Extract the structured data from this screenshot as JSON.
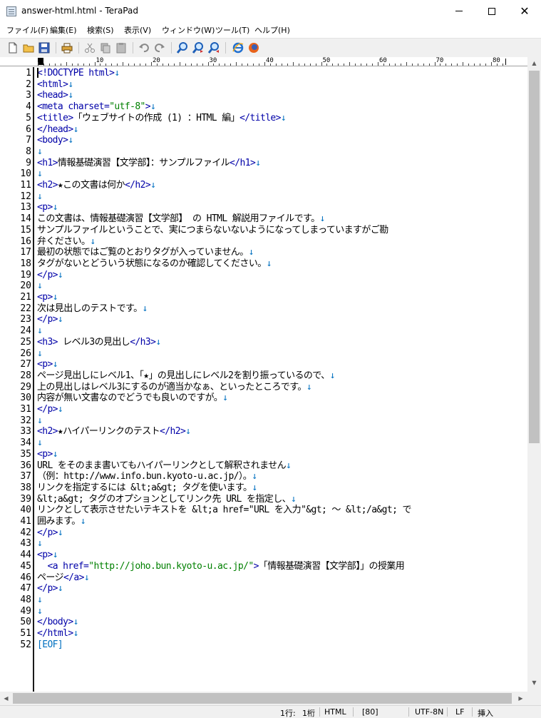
{
  "window": {
    "title": "answer-html.html - TeraPad",
    "min_glyph": "",
    "max_glyph": "",
    "close_glyph": "✕"
  },
  "menu": [
    "ファイル(F)",
    "編集(E)",
    "検索(S)",
    "表示(V)",
    "ウィンドウ(W)",
    "ツール(T)",
    "ヘルプ(H)"
  ],
  "toolbar": {
    "icons": [
      "new-file-icon",
      "open-folder-icon",
      "save-icon",
      "print-icon",
      "cut-icon",
      "copy-icon",
      "paste-icon",
      "undo-icon",
      "redo-icon",
      "find-icon",
      "find-next-icon",
      "find-prev-icon",
      "ie-browser-icon",
      "firefox-browser-icon"
    ]
  },
  "ruler": {
    "labels": [
      "0",
      "10",
      "20",
      "30",
      "40",
      "50",
      "60",
      "70",
      "80"
    ]
  },
  "editor": {
    "newline_mark": "↓",
    "eof_label": "[EOF]",
    "lines": [
      {
        "n": "1",
        "parts": [
          [
            "tag",
            "<!DOCTYPE html>"
          ],
          [
            "nl",
            "↓"
          ]
        ]
      },
      {
        "n": "2",
        "parts": [
          [
            "tag",
            "<html>"
          ],
          [
            "nl",
            "↓"
          ]
        ]
      },
      {
        "n": "3",
        "parts": [
          [
            "tag",
            "<head>"
          ],
          [
            "nl",
            "↓"
          ]
        ]
      },
      {
        "n": "4",
        "parts": [
          [
            "tag",
            "<meta charset="
          ],
          [
            "str",
            "\"utf-8\""
          ],
          [
            "tag",
            ">"
          ],
          [
            "nl",
            "↓"
          ]
        ]
      },
      {
        "n": "5",
        "parts": [
          [
            "tag",
            "<title>"
          ],
          [
            "txt",
            "「ウェブサイトの作成 (1) ：HTML 編」"
          ],
          [
            "tag",
            "</title>"
          ],
          [
            "nl",
            "↓"
          ]
        ]
      },
      {
        "n": "6",
        "parts": [
          [
            "tag",
            "</head>"
          ],
          [
            "nl",
            "↓"
          ]
        ]
      },
      {
        "n": "7",
        "parts": [
          [
            "tag",
            "<body>"
          ],
          [
            "nl",
            "↓"
          ]
        ]
      },
      {
        "n": "8",
        "parts": [
          [
            "nl",
            "↓"
          ]
        ]
      },
      {
        "n": "9",
        "parts": [
          [
            "tag",
            "<h1>"
          ],
          [
            "txt",
            "情報基礎演習【文学部】：サンプルファイル"
          ],
          [
            "tag",
            "</h1>"
          ],
          [
            "nl",
            "↓"
          ]
        ]
      },
      {
        "n": "10",
        "parts": [
          [
            "nl",
            "↓"
          ]
        ]
      },
      {
        "n": "11",
        "parts": [
          [
            "tag",
            "<h2>"
          ],
          [
            "txt",
            "★この文書は何か"
          ],
          [
            "tag",
            "</h2>"
          ],
          [
            "nl",
            "↓"
          ]
        ]
      },
      {
        "n": "12",
        "parts": [
          [
            "nl",
            "↓"
          ]
        ]
      },
      {
        "n": "13",
        "parts": [
          [
            "tag",
            "<p>"
          ],
          [
            "nl",
            "↓"
          ]
        ]
      },
      {
        "n": "14",
        "parts": [
          [
            "txt",
            "この文書は、情報基礎演習【文学部】 の HTML 解説用ファイルです。"
          ],
          [
            "nl",
            "↓"
          ]
        ]
      },
      {
        "n": "15",
        "parts": [
          [
            "txt",
            "サンプルファイルということで、実につまらないないようになってしまっていますがご勘"
          ]
        ]
      },
      {
        "n": "16",
        "parts": [
          [
            "txt",
            "弁ください。"
          ],
          [
            "nl",
            "↓"
          ]
        ]
      },
      {
        "n": "17",
        "parts": [
          [
            "txt",
            "最初の状態ではご覧のとおりタグが入っていません。"
          ],
          [
            "nl",
            "↓"
          ]
        ]
      },
      {
        "n": "18",
        "parts": [
          [
            "txt",
            "タグがないとどういう状態になるのか確認してください。"
          ],
          [
            "nl",
            "↓"
          ]
        ]
      },
      {
        "n": "19",
        "parts": [
          [
            "tag",
            "</p>"
          ],
          [
            "nl",
            "↓"
          ]
        ]
      },
      {
        "n": "20",
        "parts": [
          [
            "nl",
            "↓"
          ]
        ]
      },
      {
        "n": "21",
        "parts": [
          [
            "tag",
            "<p>"
          ],
          [
            "nl",
            "↓"
          ]
        ]
      },
      {
        "n": "22",
        "parts": [
          [
            "txt",
            "次は見出しのテストです。"
          ],
          [
            "nl",
            "↓"
          ]
        ]
      },
      {
        "n": "23",
        "parts": [
          [
            "tag",
            "</p>"
          ],
          [
            "nl",
            "↓"
          ]
        ]
      },
      {
        "n": "24",
        "parts": [
          [
            "nl",
            "↓"
          ]
        ]
      },
      {
        "n": "25",
        "parts": [
          [
            "tag",
            "<h3>"
          ],
          [
            "txt",
            " レベル3の見出し"
          ],
          [
            "tag",
            "</h3>"
          ],
          [
            "nl",
            "↓"
          ]
        ]
      },
      {
        "n": "26",
        "parts": [
          [
            "nl",
            "↓"
          ]
        ]
      },
      {
        "n": "27",
        "parts": [
          [
            "tag",
            "<p>"
          ],
          [
            "nl",
            "↓"
          ]
        ]
      },
      {
        "n": "28",
        "parts": [
          [
            "txt",
            "ページ見出しにレベル1、「★」の見出しにレベル2を割り振っているので、"
          ],
          [
            "nl",
            "↓"
          ]
        ]
      },
      {
        "n": "29",
        "parts": [
          [
            "txt",
            "上の見出しはレベル3にするのが適当かなぁ、といったところです。"
          ],
          [
            "nl",
            "↓"
          ]
        ]
      },
      {
        "n": "30",
        "parts": [
          [
            "txt",
            "内容が無い文書なのでどうでも良いのですが。"
          ],
          [
            "nl",
            "↓"
          ]
        ]
      },
      {
        "n": "31",
        "parts": [
          [
            "tag",
            "</p>"
          ],
          [
            "nl",
            "↓"
          ]
        ]
      },
      {
        "n": "32",
        "parts": [
          [
            "nl",
            "↓"
          ]
        ]
      },
      {
        "n": "33",
        "parts": [
          [
            "tag",
            "<h2>"
          ],
          [
            "txt",
            "★ハイパーリンクのテスト"
          ],
          [
            "tag",
            "</h2>"
          ],
          [
            "nl",
            "↓"
          ]
        ]
      },
      {
        "n": "34",
        "parts": [
          [
            "nl",
            "↓"
          ]
        ]
      },
      {
        "n": "35",
        "parts": [
          [
            "tag",
            "<p>"
          ],
          [
            "nl",
            "↓"
          ]
        ]
      },
      {
        "n": "36",
        "parts": [
          [
            "txt",
            "URL をそのまま書いてもハイパーリンクとして解釈されません"
          ],
          [
            "nl",
            "↓"
          ]
        ]
      },
      {
        "n": "37",
        "parts": [
          [
            "txt",
            "（例：http://www.info.bun.kyoto-u.ac.jp/）。"
          ],
          [
            "nl",
            "↓"
          ]
        ]
      },
      {
        "n": "38",
        "parts": [
          [
            "txt",
            "リンクを指定するには &lt;a&gt; タグを使います。"
          ],
          [
            "nl",
            "↓"
          ]
        ]
      },
      {
        "n": "39",
        "parts": [
          [
            "txt",
            "&lt;a&gt; タグのオプションとしてリンク先 URL を指定し、"
          ],
          [
            "nl",
            "↓"
          ]
        ]
      },
      {
        "n": "40",
        "parts": [
          [
            "txt",
            "リンクとして表示させたいテキストを &lt;a href=\"URL を入力\"&gt; ～ &lt;/a&gt; で"
          ]
        ]
      },
      {
        "n": "41",
        "parts": [
          [
            "txt",
            "囲みます。"
          ],
          [
            "nl",
            "↓"
          ]
        ]
      },
      {
        "n": "42",
        "parts": [
          [
            "tag",
            "</p>"
          ],
          [
            "nl",
            "↓"
          ]
        ]
      },
      {
        "n": "43",
        "parts": [
          [
            "nl",
            "↓"
          ]
        ]
      },
      {
        "n": "44",
        "parts": [
          [
            "tag",
            "<p>"
          ],
          [
            "nl",
            "↓"
          ]
        ]
      },
      {
        "n": "45",
        "parts": [
          [
            "txt",
            "  "
          ],
          [
            "tag",
            "<a href="
          ],
          [
            "str",
            "\"http://joho.bun.kyoto-u.ac.jp/\""
          ],
          [
            "tag",
            ">"
          ],
          [
            "txt",
            "「情報基礎演習【文学部】」の授業用"
          ]
        ]
      },
      {
        "n": "46",
        "parts": [
          [
            "txt",
            "ページ"
          ],
          [
            "tag",
            "</a>"
          ],
          [
            "nl",
            "↓"
          ]
        ]
      },
      {
        "n": "47",
        "parts": [
          [
            "tag",
            "</p>"
          ],
          [
            "nl",
            "↓"
          ]
        ]
      },
      {
        "n": "48",
        "parts": [
          [
            "nl",
            "↓"
          ]
        ]
      },
      {
        "n": "49",
        "parts": [
          [
            "nl",
            "↓"
          ]
        ]
      },
      {
        "n": "50",
        "parts": [
          [
            "tag",
            "</body>"
          ],
          [
            "nl",
            "↓"
          ]
        ]
      },
      {
        "n": "51",
        "parts": [
          [
            "tag",
            "</html>"
          ],
          [
            "nl",
            "↓"
          ]
        ]
      },
      {
        "n": "52",
        "parts": [
          [
            "eof",
            "[EOF]"
          ]
        ]
      }
    ]
  },
  "status": {
    "position": "1行:",
    "column": "1桁",
    "mode": "HTML",
    "wrap": "[80]",
    "encoding": "UTF-8N",
    "linebreak": "LF",
    "insert": "挿入"
  },
  "scrollbars": {
    "up_glyph": "▲",
    "down_glyph": "▼",
    "left_glyph": "◀",
    "right_glyph": "▶"
  }
}
